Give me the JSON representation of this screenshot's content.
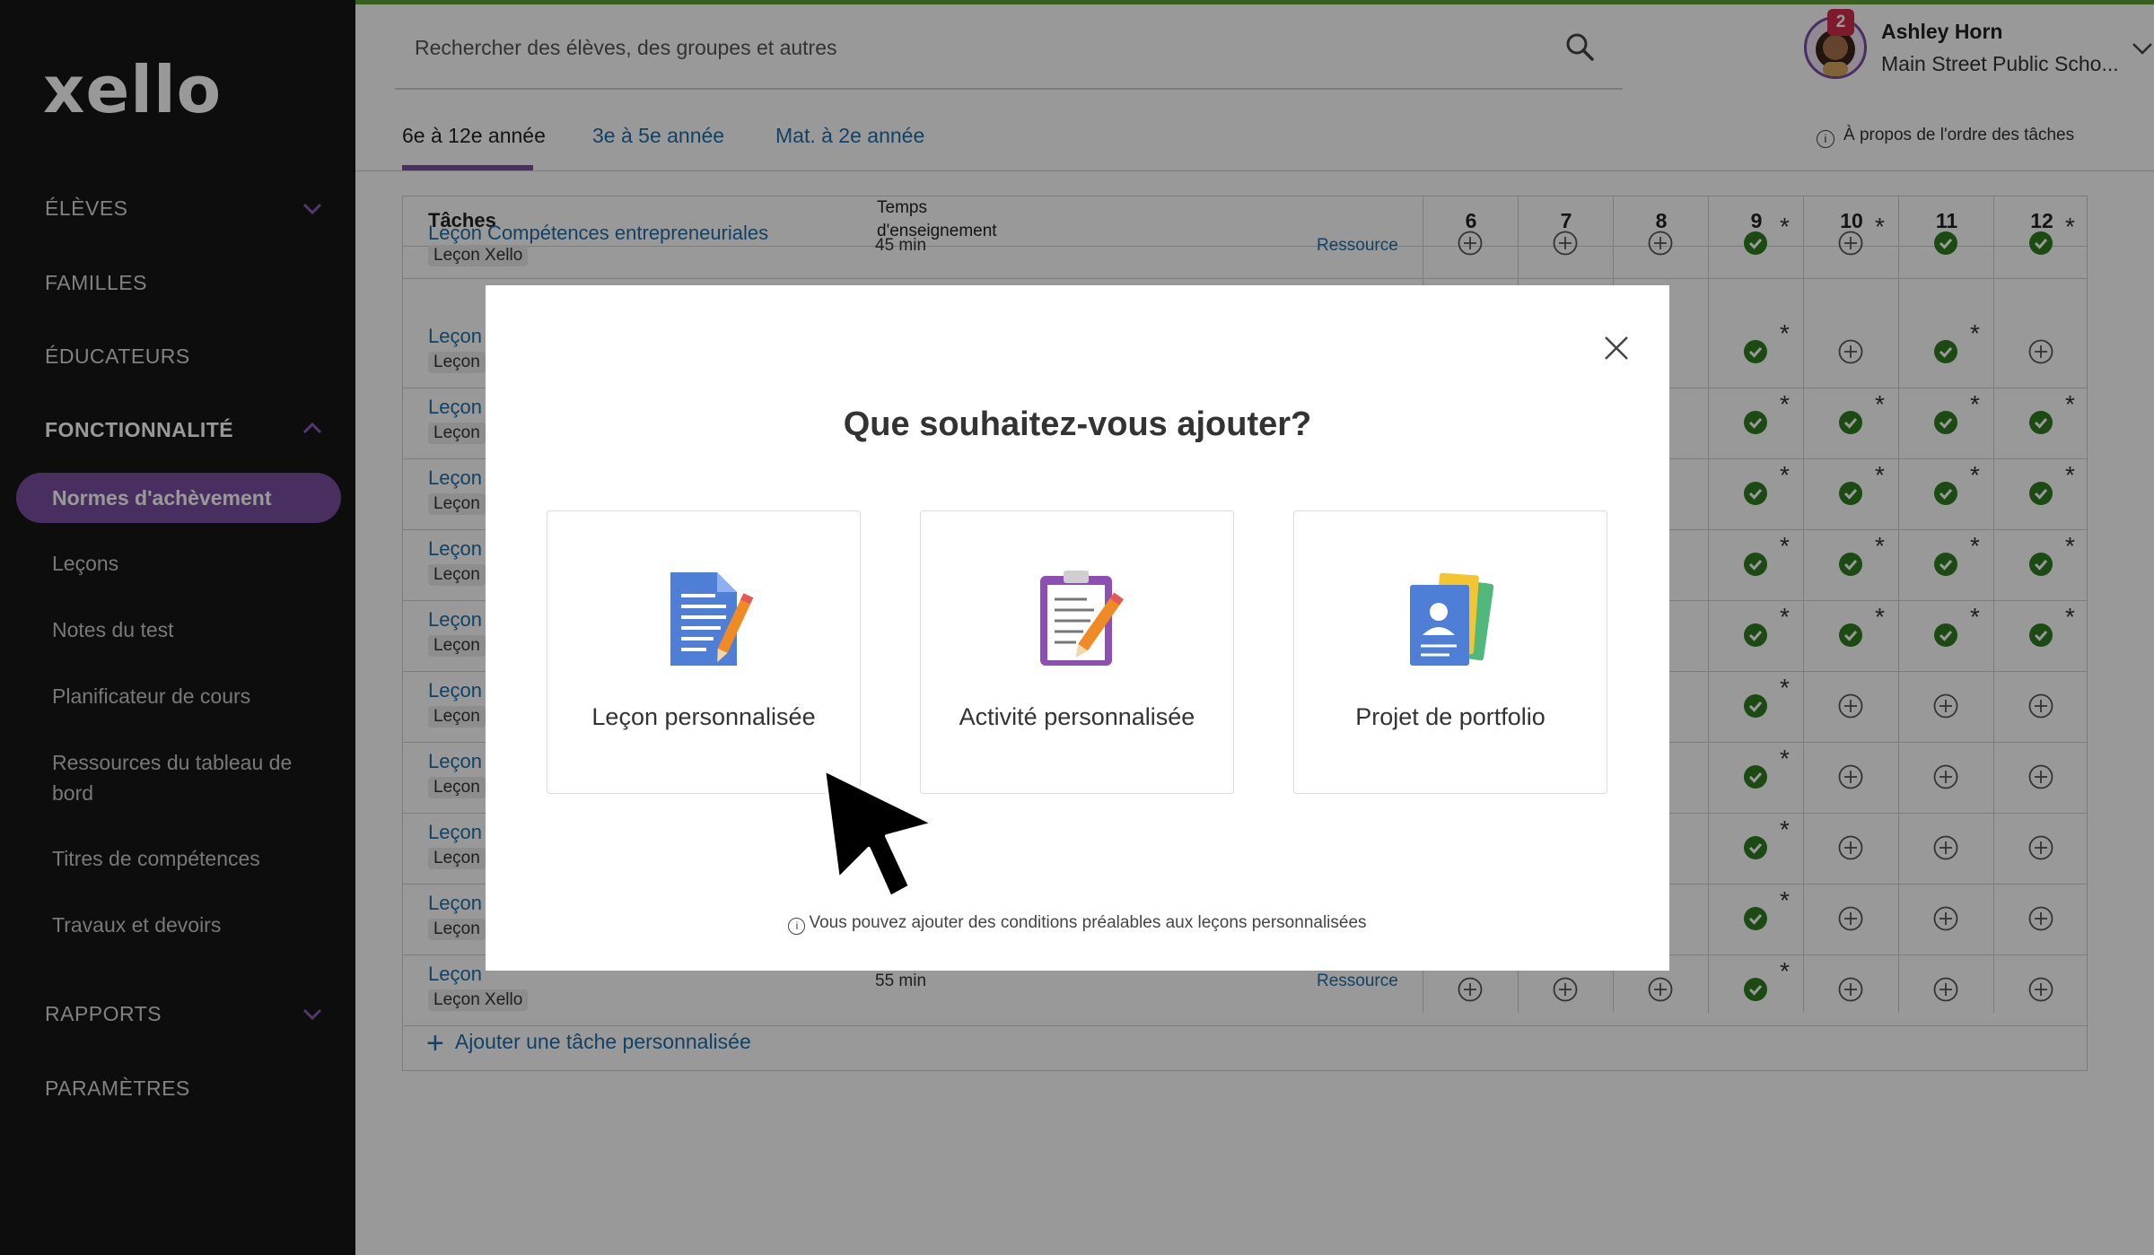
{
  "brand": {
    "logo": "xello"
  },
  "sidebar": {
    "sections": [
      {
        "label": "ÉLÈVES"
      },
      {
        "label": "FAMILLES"
      },
      {
        "label": "ÉDUCATEURS"
      },
      {
        "label": "FONCTIONNALITÉ"
      },
      {
        "label": "RAPPORTS"
      },
      {
        "label": "PARAMÈTRES"
      }
    ],
    "active_item": "Normes d'achèvement",
    "items": [
      {
        "label": "Leçons"
      },
      {
        "label": "Notes du test"
      },
      {
        "label": "Planificateur de cours"
      },
      {
        "label": "Ressources du tableau de bord"
      },
      {
        "label": "Titres de compétences"
      },
      {
        "label": "Travaux et devoirs"
      }
    ]
  },
  "header": {
    "search_placeholder": "Rechercher des élèves, des groupes et autres",
    "notification_count": "2",
    "user_name": "Ashley Horn",
    "user_school": "Main Street Public Scho..."
  },
  "tabs": [
    {
      "label": "6e à 12e année",
      "active": true
    },
    {
      "label": "3e à 5e année",
      "active": false
    },
    {
      "label": "Mat. à 2e année",
      "active": false
    }
  ],
  "about_order": "À propos de l'ordre des tâches",
  "table": {
    "col_tasks": "Tâches",
    "col_time_line1": "Temps",
    "col_time_line2": "d'enseignement",
    "grades": [
      "6",
      "7",
      "8",
      "9",
      "10",
      "11",
      "12"
    ],
    "rows": [
      {
        "title": "Leçon Compétences entrepreneuriales",
        "tag": "Leçon Xello",
        "time": "45 min",
        "resource": "Ressource"
      },
      {
        "title": "Leçon",
        "tag": "Leçon"
      },
      {
        "title": "Leçon",
        "tag": "Leçon"
      },
      {
        "title": "Leçon",
        "tag": "Leçon"
      },
      {
        "title": "Leçon",
        "tag": "Leçon"
      },
      {
        "title": "Leçon",
        "tag": "Leçon"
      },
      {
        "title": "Leçon",
        "tag": "Leçon"
      },
      {
        "title": "Leçon",
        "tag": "Leçon"
      },
      {
        "title": "Leçon",
        "tag": "Leçon"
      },
      {
        "title": "Leçon",
        "tag": "Leçon"
      },
      {
        "title": "Leçon",
        "tag": "Leçon Xello",
        "time": "55 min",
        "resource": "Ressource"
      }
    ],
    "add_custom_task": "Ajouter une tâche personnalisée"
  },
  "modal": {
    "title": "Que souhaitez-vous ajouter?",
    "options": [
      {
        "label": "Leçon personnalisée",
        "icon": "document-pencil-icon"
      },
      {
        "label": "Activité personnalisée",
        "icon": "clipboard-pencil-icon"
      },
      {
        "label": "Projet de portfolio",
        "icon": "portfolio-cards-icon"
      }
    ],
    "note": "Vous pouvez ajouter des conditions préalables aux leçons personnalisées"
  },
  "colors": {
    "accent": "#7b4da0",
    "sidebar_bg": "#161616",
    "link": "#1f6fa6",
    "check_green": "#2e7d1f",
    "top_strip": "#5e9e36"
  }
}
